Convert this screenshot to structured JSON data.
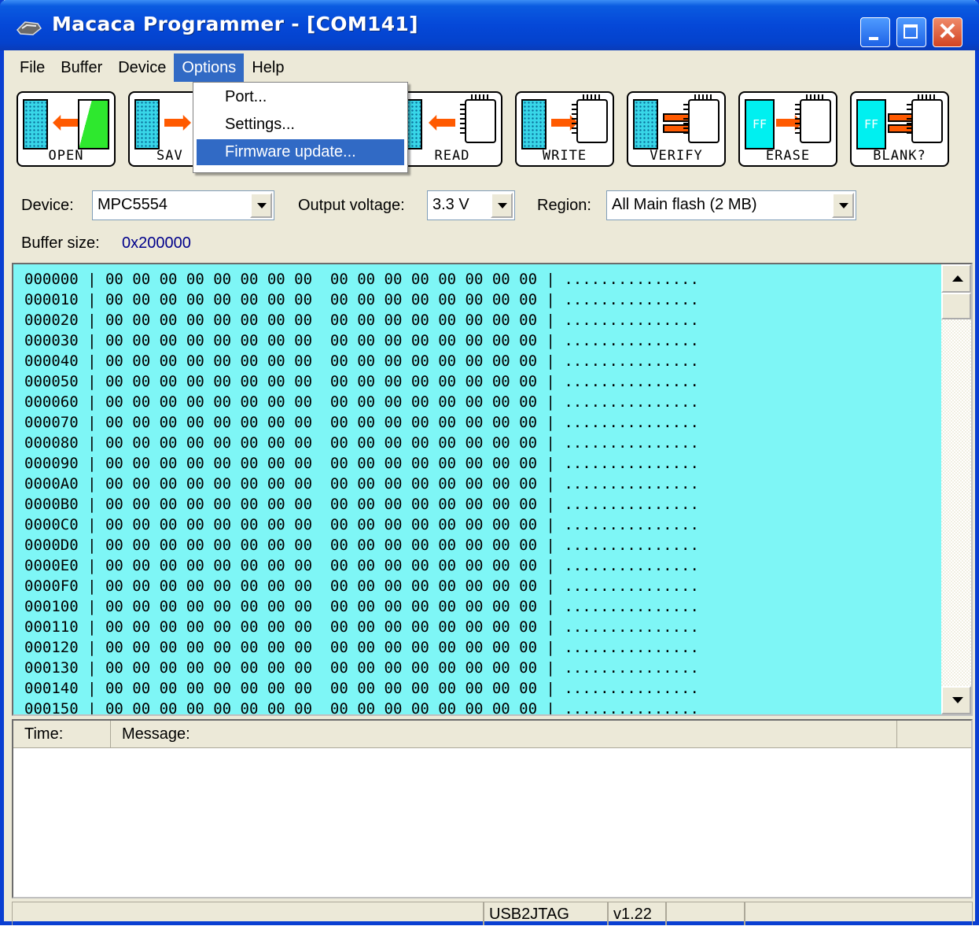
{
  "window": {
    "title": "Macaca Programmer - [COM141]"
  },
  "menubar": {
    "items": [
      "File",
      "Buffer",
      "Device",
      "Options",
      "Help"
    ],
    "active": "Options"
  },
  "options_menu": {
    "items": [
      "Port...",
      "Settings...",
      "Firmware update..."
    ],
    "selected": "Firmware update..."
  },
  "toolbar": {
    "open": "OPEN",
    "save": "SAV",
    "read": "READ",
    "write": "WRITE",
    "verify": "VERIFY",
    "erase": "ERASE",
    "blank": "BLANK?",
    "ff": "FF"
  },
  "params": {
    "device_label": "Device:",
    "device_value": "MPC5554",
    "voltage_label": "Output voltage:",
    "voltage_value": "3.3 V",
    "region_label": "Region:",
    "region_value": "All Main flash (2 MB)",
    "buffer_size_label": "Buffer size:",
    "buffer_size_value": "0x200000"
  },
  "hexview": {
    "addresses": [
      "000000",
      "000010",
      "000020",
      "000030",
      "000040",
      "000050",
      "000060",
      "000070",
      "000080",
      "000090",
      "0000A0",
      "0000B0",
      "0000C0",
      "0000D0",
      "0000E0",
      "0000F0",
      "000100",
      "000110",
      "000120",
      "000130",
      "000140",
      "000150"
    ],
    "bytes": [
      "00",
      "00",
      "00",
      "00",
      "00",
      "00",
      "00",
      "00",
      "00",
      "00",
      "00",
      "00",
      "00",
      "00",
      "00",
      "00"
    ],
    "ascii": "..............."
  },
  "log": {
    "time_header": "Time:",
    "message_header": "Message:"
  },
  "statusbar": {
    "interface": "USB2JTAG",
    "version": "v1.22"
  },
  "colors": {
    "hex_background": "#7ef6f6",
    "selection": "#316ac5",
    "titlebar": "#0548d8"
  },
  "icons": [
    "app-icon",
    "minimize-icon",
    "maximize-icon",
    "close-icon",
    "combo-arrow-icon",
    "scroll-up-icon",
    "scroll-down-icon"
  ]
}
